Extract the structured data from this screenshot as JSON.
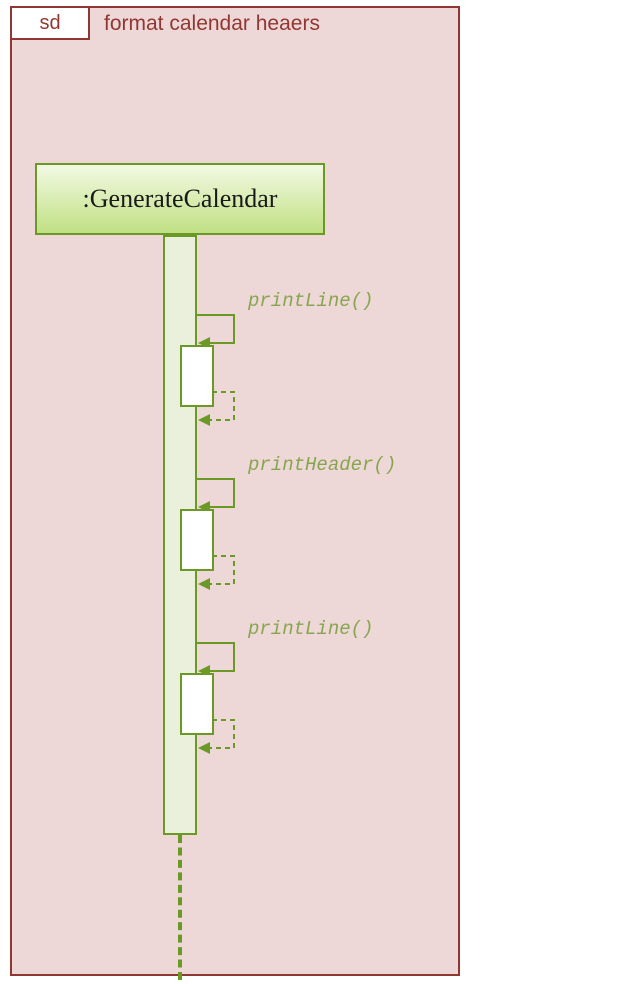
{
  "frame": {
    "tab": "sd",
    "title": "format calendar heaers"
  },
  "participant": {
    "name": ":GenerateCalendar"
  },
  "messages": {
    "call1": "printLine()",
    "call2": "printHeader()",
    "call3": "printLine()"
  }
}
